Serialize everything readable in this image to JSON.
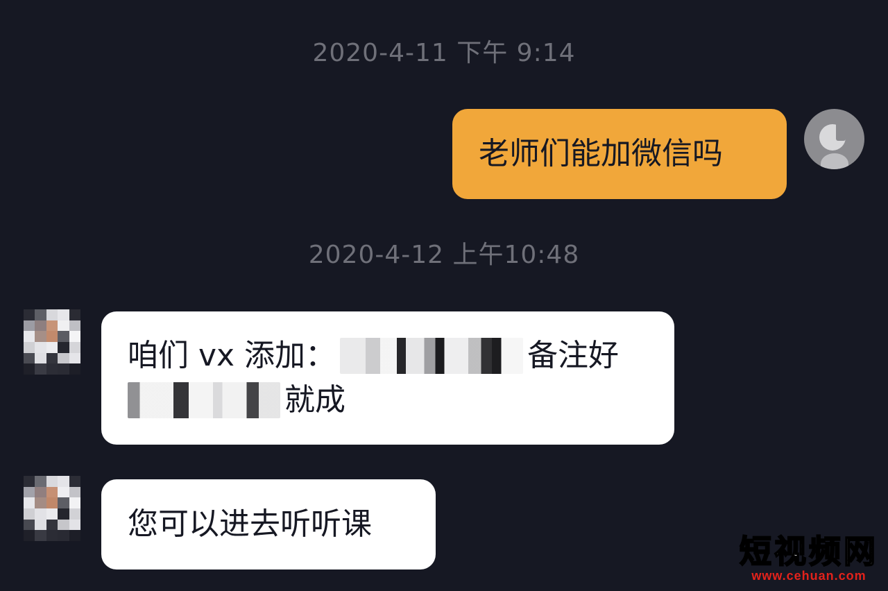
{
  "timestamps": [
    "2020-4-11 下午 9:14",
    "2020-4-12 上午10:48"
  ],
  "messages": {
    "outgoing_1": "老师们能加微信吗",
    "incoming_1_line1_prefix": "咱们 vx 添加：",
    "incoming_1_line1_suffix": "备注好",
    "incoming_1_line2_suffix": "就成",
    "incoming_2": "您可以进去听听课"
  },
  "icons": {
    "self_avatar": "music-note-avatar-icon",
    "contact_avatar": "pixelated-avatar-icon"
  },
  "watermark": {
    "title": "短视频网",
    "url": "www.cehuan.com"
  },
  "colors": {
    "background": "#161823",
    "outgoing_bubble": "#f1a73a",
    "incoming_bubble": "#ffffff",
    "timestamp": "#6f7079",
    "watermark_url": "#e3221b"
  }
}
